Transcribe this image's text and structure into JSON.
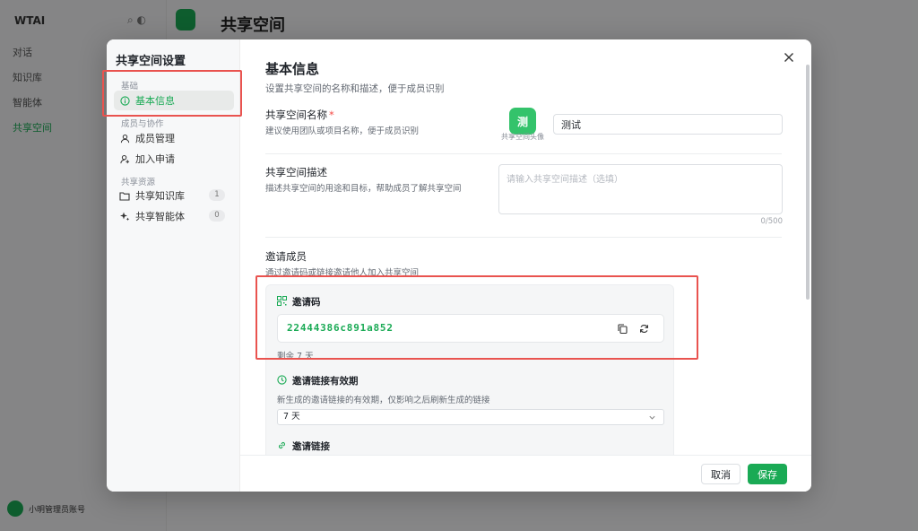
{
  "background": {
    "logo": "WTAI",
    "title": "共享空间",
    "nav": [
      "对话",
      "知识库",
      "智能体",
      "共享空间"
    ],
    "user_name": "小明管理员账号"
  },
  "modal": {
    "sidebar": {
      "title": "共享空间设置",
      "groups": [
        {
          "label": "基础",
          "items": [
            {
              "label": "基本信息",
              "icon": "info-circle-icon",
              "active": true
            }
          ]
        },
        {
          "label": "成员与协作",
          "items": [
            {
              "label": "成员管理",
              "icon": "user-icon"
            },
            {
              "label": "加入申请",
              "icon": "user-add-icon"
            }
          ]
        },
        {
          "label": "共享资源",
          "items": [
            {
              "label": "共享知识库",
              "icon": "folder-icon",
              "count": "1"
            },
            {
              "label": "共享智能体",
              "icon": "sparkle-icon",
              "count": "0"
            }
          ]
        }
      ]
    },
    "header": {
      "title": "基本信息",
      "subtitle": "设置共享空间的名称和描述，便于成员识别"
    },
    "name_field": {
      "label": "共享空间名称",
      "required_mark": "*",
      "help": "建议使用团队或项目名称，便于成员识别",
      "avatar_char": "测",
      "avatar_caption": "共享空间头像",
      "value": "测试"
    },
    "desc_field": {
      "label": "共享空间描述",
      "help": "描述共享空间的用途和目标，帮助成员了解共享空间",
      "placeholder": "请输入共享空间描述（选填）",
      "count": "0/500"
    },
    "invite": {
      "label": "邀请成员",
      "help": "通过邀请码或链接邀请他人加入共享空间",
      "code_title": "邀请码",
      "code": "22444386c891a852",
      "remaining": "剩余 7 天",
      "expiry_title": "邀请链接有效期",
      "expiry_desc": "新生成的邀请链接的有效期，仅影响之后刷新生成的链接",
      "expiry_value": "7 天",
      "link_title": "邀请链接"
    },
    "footer": {
      "cancel": "取消",
      "save": "保存"
    }
  },
  "colors": {
    "accent": "#1aaa55",
    "highlight": "#e9534f"
  }
}
